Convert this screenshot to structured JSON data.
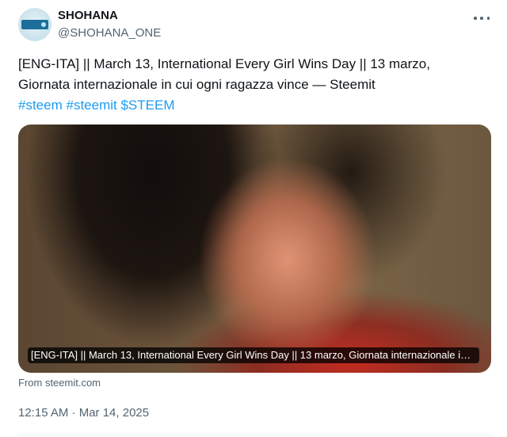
{
  "author": {
    "display_name": "SHOHANA",
    "handle": "@SHOHANA_ONE",
    "avatar_icon": "profile-avatar"
  },
  "menu": {
    "icon": "more-options-icon"
  },
  "tweet": {
    "line1": "[ENG-ITA] || March 13,  International Every Girl Wins Day   || 13 marzo,",
    "line2": "Giornata internazionale in cui ogni ragazza vince — Steemit",
    "tags": [
      "#steem",
      "#steemit",
      "$STEEM"
    ]
  },
  "card": {
    "caption": "[ENG-ITA] || March 13, International Every Girl Wins Day || 13 marzo, Giornata internazionale in cui ogni ragazza vince — Steemit",
    "source": "From steemit.com"
  },
  "timestamp": "12:15 AM · Mar 14, 2025",
  "colors": {
    "text": "#0f1419",
    "secondary": "#536471",
    "link": "#1d9bf0"
  }
}
